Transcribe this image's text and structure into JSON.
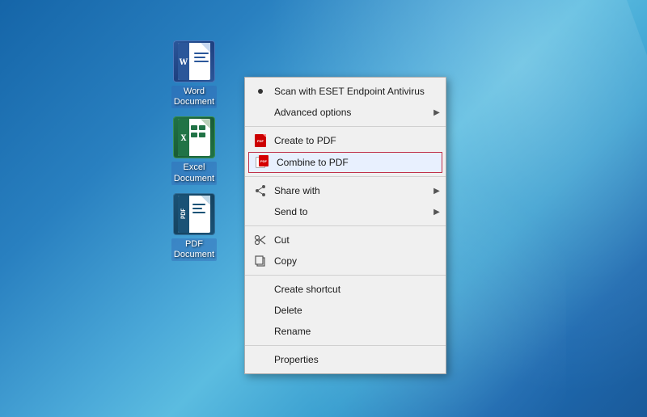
{
  "desktop": {
    "background_color": "#1a6fa8"
  },
  "icons": [
    {
      "id": "word-document",
      "label_line1": "Word",
      "label_line2": "Document",
      "type": "word"
    },
    {
      "id": "excel-document",
      "label_line1": "Excel",
      "label_line2": "Document",
      "type": "excel"
    },
    {
      "id": "pdf-document",
      "label_line1": "PDF",
      "label_line2": "Document",
      "type": "pdf"
    }
  ],
  "context_menu": {
    "items": [
      {
        "id": "scan-eset",
        "label": "Scan with ESET Endpoint Antivirus",
        "icon": "eset",
        "has_arrow": false,
        "has_bullet": true,
        "separator_after": false
      },
      {
        "id": "advanced-options",
        "label": "Advanced options",
        "icon": "none",
        "has_arrow": true,
        "has_bullet": false,
        "separator_after": true
      },
      {
        "id": "create-pdf",
        "label": "Create to PDF",
        "icon": "pdf",
        "has_arrow": false,
        "has_bullet": false,
        "separator_after": false
      },
      {
        "id": "combine-pdf",
        "label": "Combine to PDF",
        "icon": "combine-pdf",
        "has_arrow": false,
        "has_bullet": false,
        "highlighted": true,
        "separator_after": true
      },
      {
        "id": "share-with",
        "label": "Share with",
        "icon": "share",
        "has_arrow": true,
        "has_bullet": false,
        "separator_after": false
      },
      {
        "id": "send-to",
        "label": "Send to",
        "icon": "none",
        "has_arrow": true,
        "has_bullet": false,
        "separator_after": true
      },
      {
        "id": "cut",
        "label": "Cut",
        "icon": "none",
        "has_arrow": false,
        "has_bullet": false,
        "separator_after": false
      },
      {
        "id": "copy",
        "label": "Copy",
        "icon": "none",
        "has_arrow": false,
        "has_bullet": false,
        "separator_after": true
      },
      {
        "id": "create-shortcut",
        "label": "Create shortcut",
        "icon": "none",
        "has_arrow": false,
        "has_bullet": false,
        "separator_after": false
      },
      {
        "id": "delete",
        "label": "Delete",
        "icon": "none",
        "has_arrow": false,
        "has_bullet": false,
        "separator_after": false
      },
      {
        "id": "rename",
        "label": "Rename",
        "icon": "none",
        "has_arrow": false,
        "has_bullet": false,
        "separator_after": true
      },
      {
        "id": "properties",
        "label": "Properties",
        "icon": "none",
        "has_arrow": false,
        "has_bullet": false,
        "separator_after": false
      }
    ]
  }
}
